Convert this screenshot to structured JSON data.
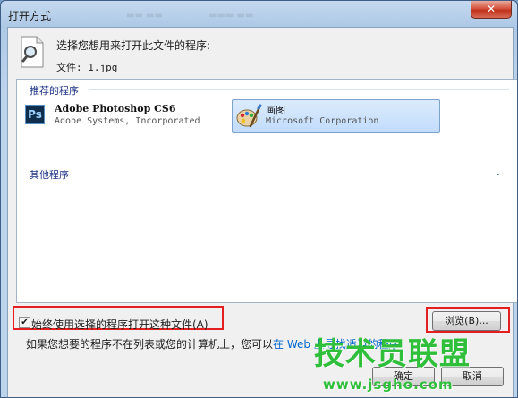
{
  "window": {
    "title": "打开方式",
    "close_symbol": "✕"
  },
  "dialog": {
    "prompt": "选择您想用来打开此文件的程序:",
    "file_line": "文件: 1.jpg"
  },
  "programs": {
    "recommended_header": "推荐的程序",
    "other_header": "其他程序",
    "items": [
      {
        "name": "Adobe Photoshop CS6",
        "publisher": "Adobe Systems, Incorporated",
        "icon": "photoshop-icon",
        "icon_text": "Ps",
        "selected": false
      },
      {
        "name": "画图",
        "publisher": "Microsoft Corporation",
        "icon": "paint-palette-icon",
        "selected": true
      }
    ],
    "expand_icon": "⌄"
  },
  "options": {
    "always_use_label": "始终使用选择的程序打开这种文件(A)",
    "always_use_checked": true,
    "check_glyph": "✔"
  },
  "buttons": {
    "browse": "浏览(B)...",
    "ok": "确定",
    "cancel": "取消"
  },
  "hint": {
    "prefix": "如果您想要的程序不在列表或您的计算机上，您可以",
    "link": "在 Web 上寻找适当的程序"
  },
  "watermark": {
    "brand": "技术员联盟",
    "url": "www.jsgho.com"
  },
  "colors": {
    "highlight_box": "#e51f1f",
    "selected_item": "#c1dcfc",
    "link": "#0066cc",
    "watermark": "#2fbf3a"
  }
}
